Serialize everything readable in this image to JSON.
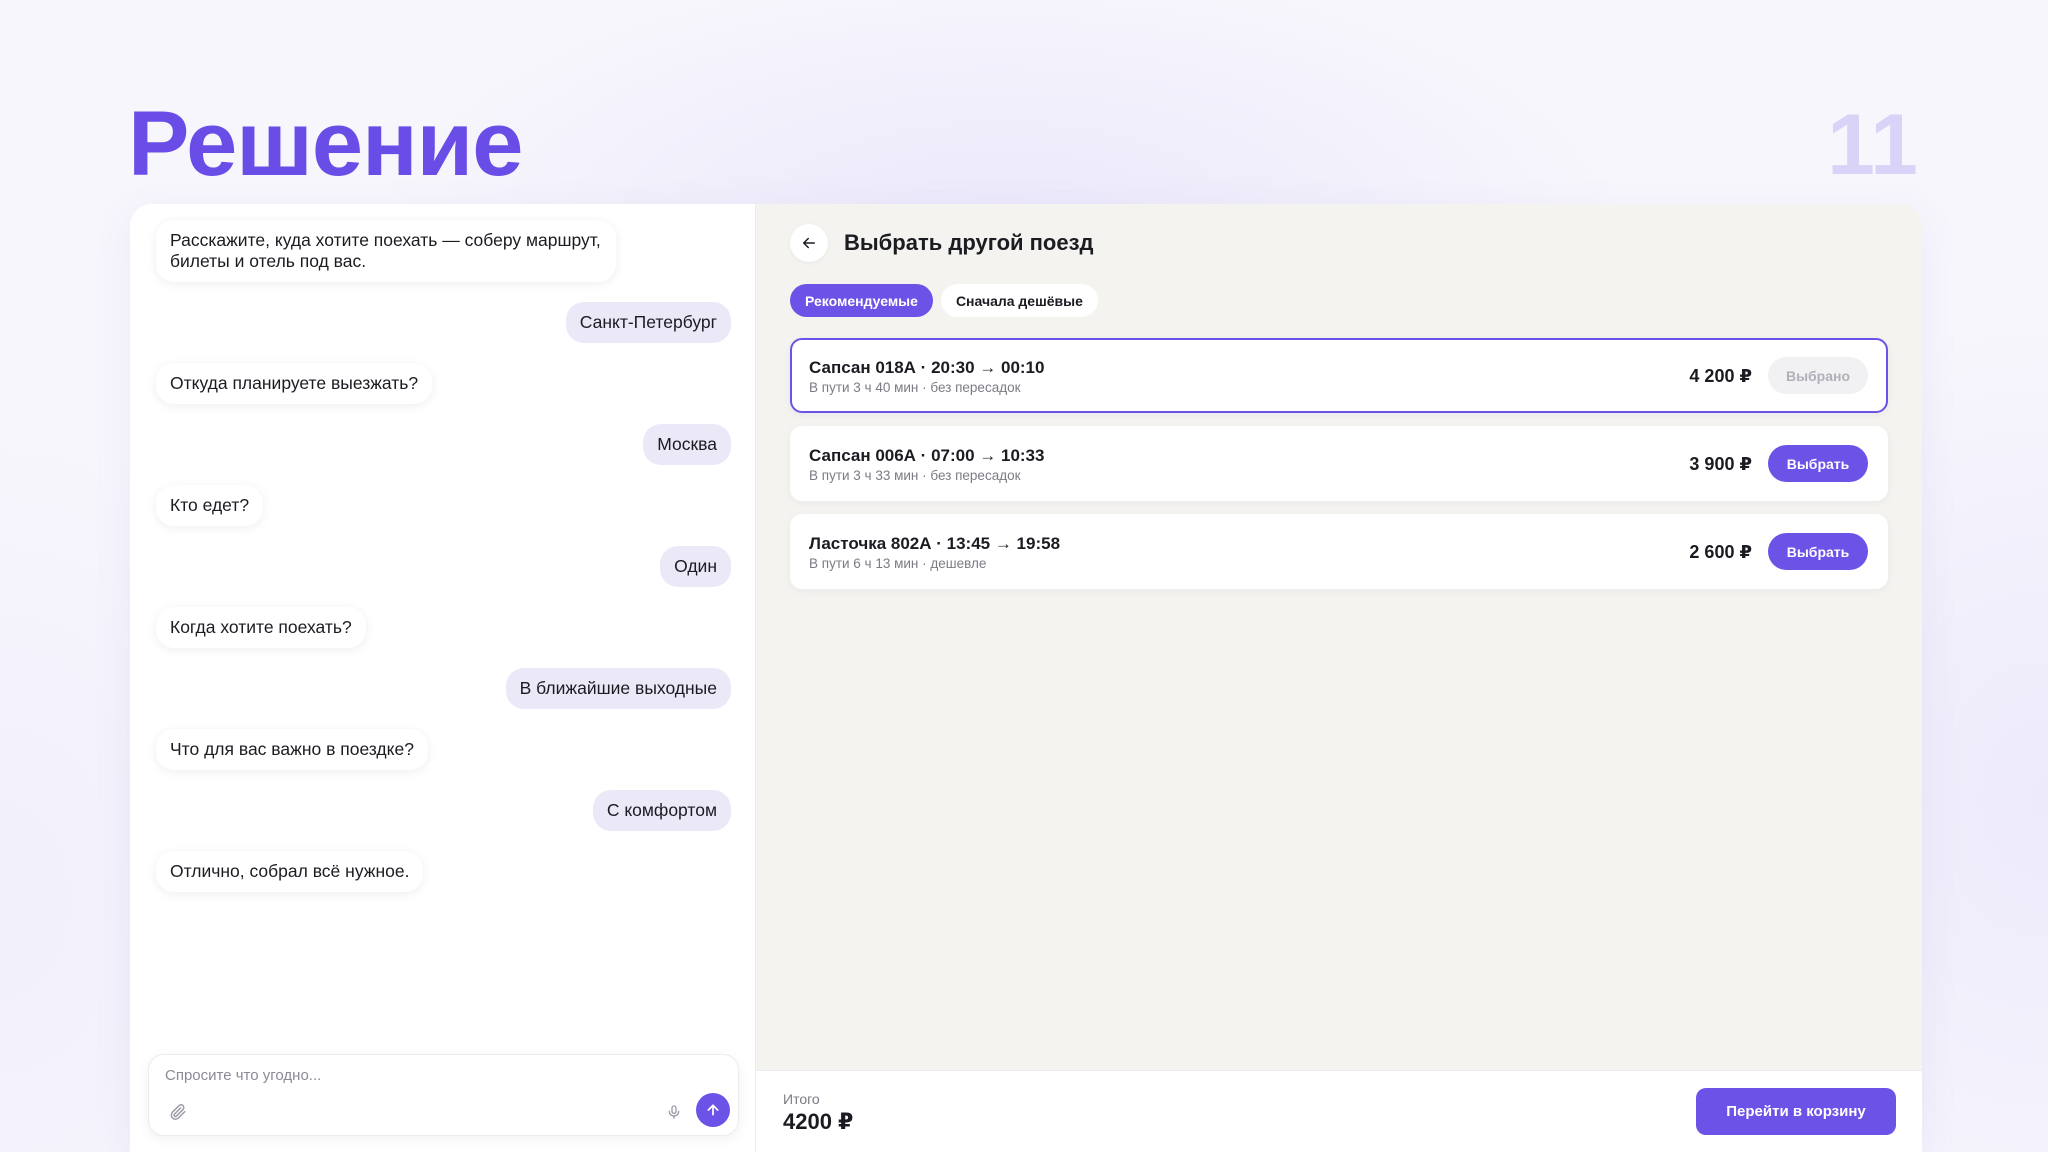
{
  "slide": {
    "title": "Решение",
    "number": "11"
  },
  "colors": {
    "accent": "#6c52e6",
    "title": "#6a4de6",
    "slide_number": "#d9d3f8",
    "user_bubble": "#ebe8f8",
    "panel_bg": "#f4f3f0"
  },
  "chat": {
    "messages": [
      {
        "role": "bot",
        "text": "Расскажите, куда хотите поехать — соберу маршрут, билеты и отель под вас."
      },
      {
        "role": "user",
        "text": "Санкт-Петербург"
      },
      {
        "role": "bot",
        "text": "Откуда планируете выезжать?"
      },
      {
        "role": "user",
        "text": "Москва"
      },
      {
        "role": "bot",
        "text": "Кто едет?"
      },
      {
        "role": "user",
        "text": "Один"
      },
      {
        "role": "bot",
        "text": "Когда хотите поехать?"
      },
      {
        "role": "user",
        "text": "В ближайшие выходные"
      },
      {
        "role": "bot",
        "text": "Что для вас важно в поездке?"
      },
      {
        "role": "user",
        "text": "С комфортом"
      },
      {
        "role": "bot",
        "text": "Отлично, собрал всё нужное."
      }
    ],
    "composer": {
      "placeholder": "Спросите что угодно...",
      "value": "",
      "icons": [
        "paperclip-icon",
        "microphone-icon",
        "arrow-up-icon"
      ]
    }
  },
  "trains": {
    "back_icon": "arrow-left-icon",
    "title": "Выбрать другой поезд",
    "filters": [
      {
        "label": "Рекомендуемые",
        "active": true
      },
      {
        "label": "Сначала дешёвые",
        "active": false
      }
    ],
    "items": [
      {
        "name": "Сапсан 018А · 20:30 → 00:10",
        "details": "В пути 3 ч 40 мин · без пересадок",
        "price": "4 200 ₽",
        "button": "Выбрано",
        "selected": true
      },
      {
        "name": "Сапсан 006А · 07:00 → 10:33",
        "details": "В пути 3 ч 33 мин · без пересадок",
        "price": "3 900 ₽",
        "button": "Выбрать",
        "selected": false
      },
      {
        "name": "Ласточка 802А · 13:45 → 19:58",
        "details": "В пути 6 ч 13 мин · дешевле",
        "price": "2 600 ₽",
        "button": "Выбрать",
        "selected": false
      }
    ],
    "footer": {
      "total_label": "Итого",
      "total_value": "4200 ₽",
      "cart_button": "Перейти в корзину"
    }
  }
}
